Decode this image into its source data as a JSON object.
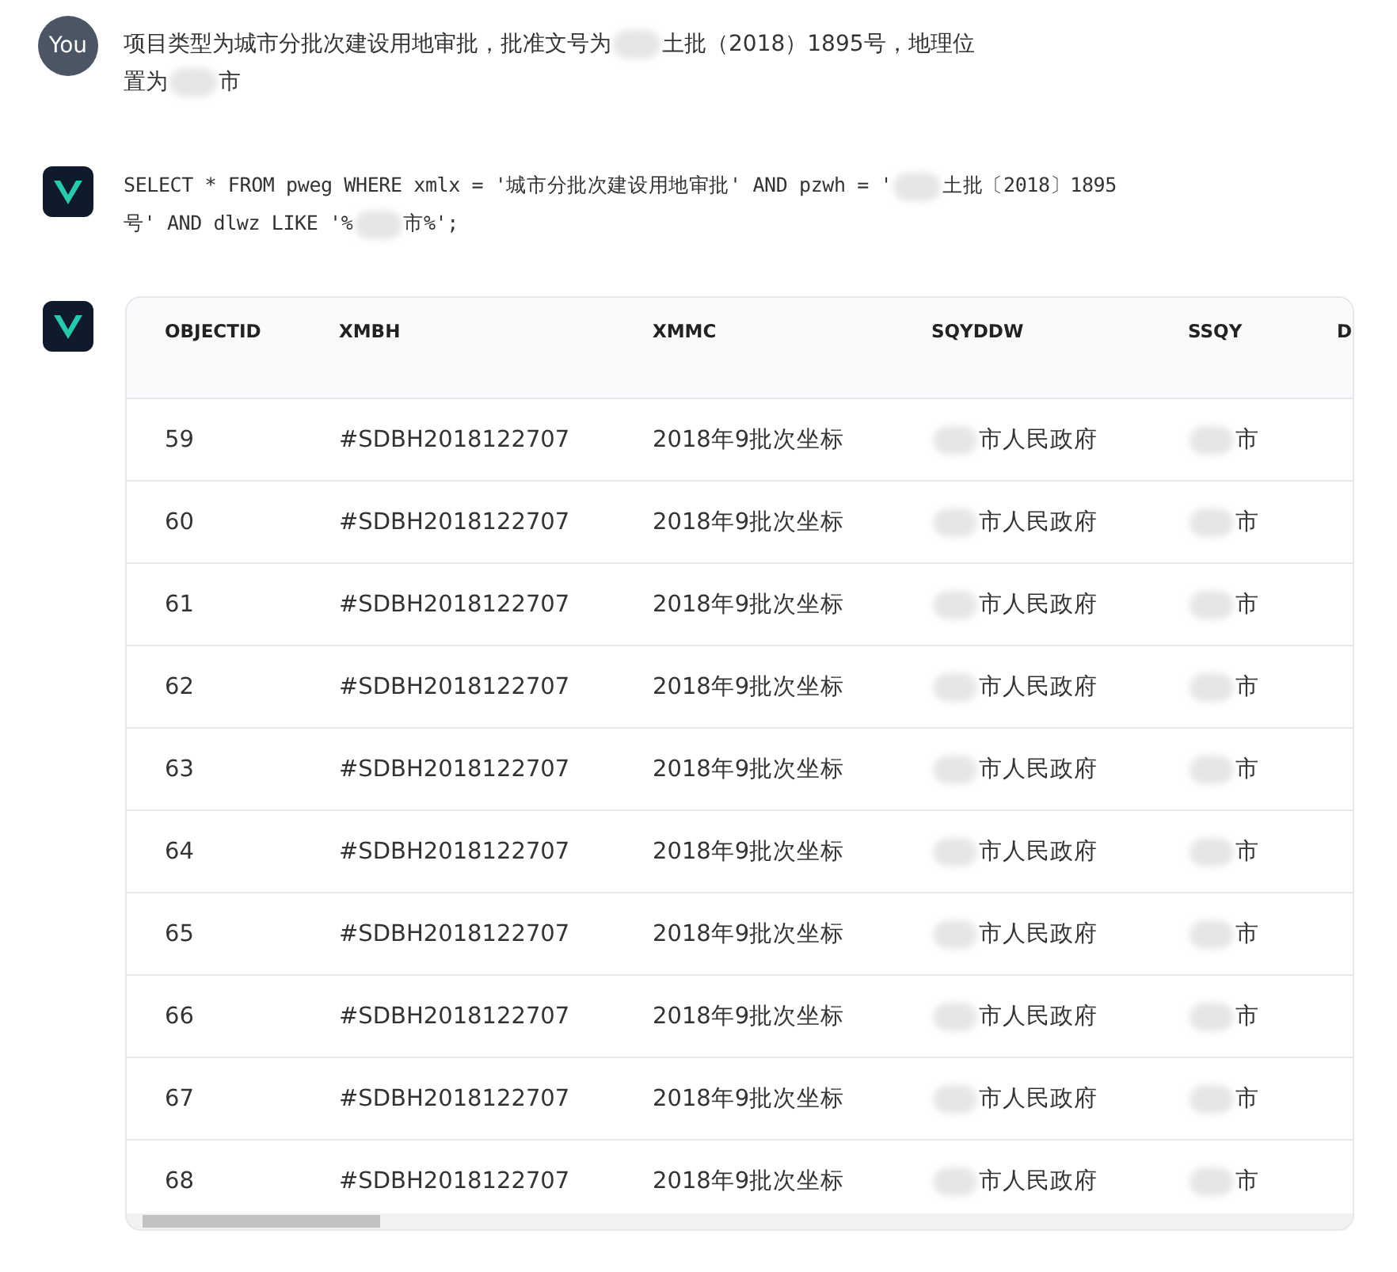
{
  "user_message": {
    "avatar": "You",
    "lines": [
      [
        "项目类型为城市分批次建设用地审批，批准文号为",
        "土批（2018）1895号，地理位"
      ],
      [
        "置为",
        "市"
      ]
    ]
  },
  "sql_reply": {
    "lines": [
      [
        "SELECT * FROM pweg WHERE xmlx = '城市分批次建设用地审批' AND pzwh = '",
        "土批〔2018〕1895"
      ],
      [
        "号' AND dlwz LIKE '%",
        "市%';"
      ]
    ]
  },
  "table": {
    "columns": [
      "OBJECTID",
      "XMBH",
      "XMMC",
      "SQYDDW",
      "SSQY",
      "D"
    ],
    "rows": [
      {
        "objectid": "59",
        "xmbh": "#SDBH2018122707",
        "xmmc": "2018年9批次坐标",
        "sqyddw": "市人民政府",
        "ssqy": "市"
      },
      {
        "objectid": "60",
        "xmbh": "#SDBH2018122707",
        "xmmc": "2018年9批次坐标",
        "sqyddw": "市人民政府",
        "ssqy": "市"
      },
      {
        "objectid": "61",
        "xmbh": "#SDBH2018122707",
        "xmmc": "2018年9批次坐标",
        "sqyddw": "市人民政府",
        "ssqy": "市"
      },
      {
        "objectid": "62",
        "xmbh": "#SDBH2018122707",
        "xmmc": "2018年9批次坐标",
        "sqyddw": "市人民政府",
        "ssqy": "市"
      },
      {
        "objectid": "63",
        "xmbh": "#SDBH2018122707",
        "xmmc": "2018年9批次坐标",
        "sqyddw": "市人民政府",
        "ssqy": "市"
      },
      {
        "objectid": "64",
        "xmbh": "#SDBH2018122707",
        "xmmc": "2018年9批次坐标",
        "sqyddw": "市人民政府",
        "ssqy": "市"
      },
      {
        "objectid": "65",
        "xmbh": "#SDBH2018122707",
        "xmmc": "2018年9批次坐标",
        "sqyddw": "市人民政府",
        "ssqy": "市"
      },
      {
        "objectid": "66",
        "xmbh": "#SDBH2018122707",
        "xmmc": "2018年9批次坐标",
        "sqyddw": "市人民政府",
        "ssqy": "市"
      },
      {
        "objectid": "67",
        "xmbh": "#SDBH2018122707",
        "xmmc": "2018年9批次坐标",
        "sqyddw": "市人民政府",
        "ssqy": "市"
      },
      {
        "objectid": "68",
        "xmbh": "#SDBH2018122707",
        "xmmc": "2018年9批次坐标",
        "sqyddw": "市人民政府",
        "ssqy": "市"
      }
    ]
  }
}
